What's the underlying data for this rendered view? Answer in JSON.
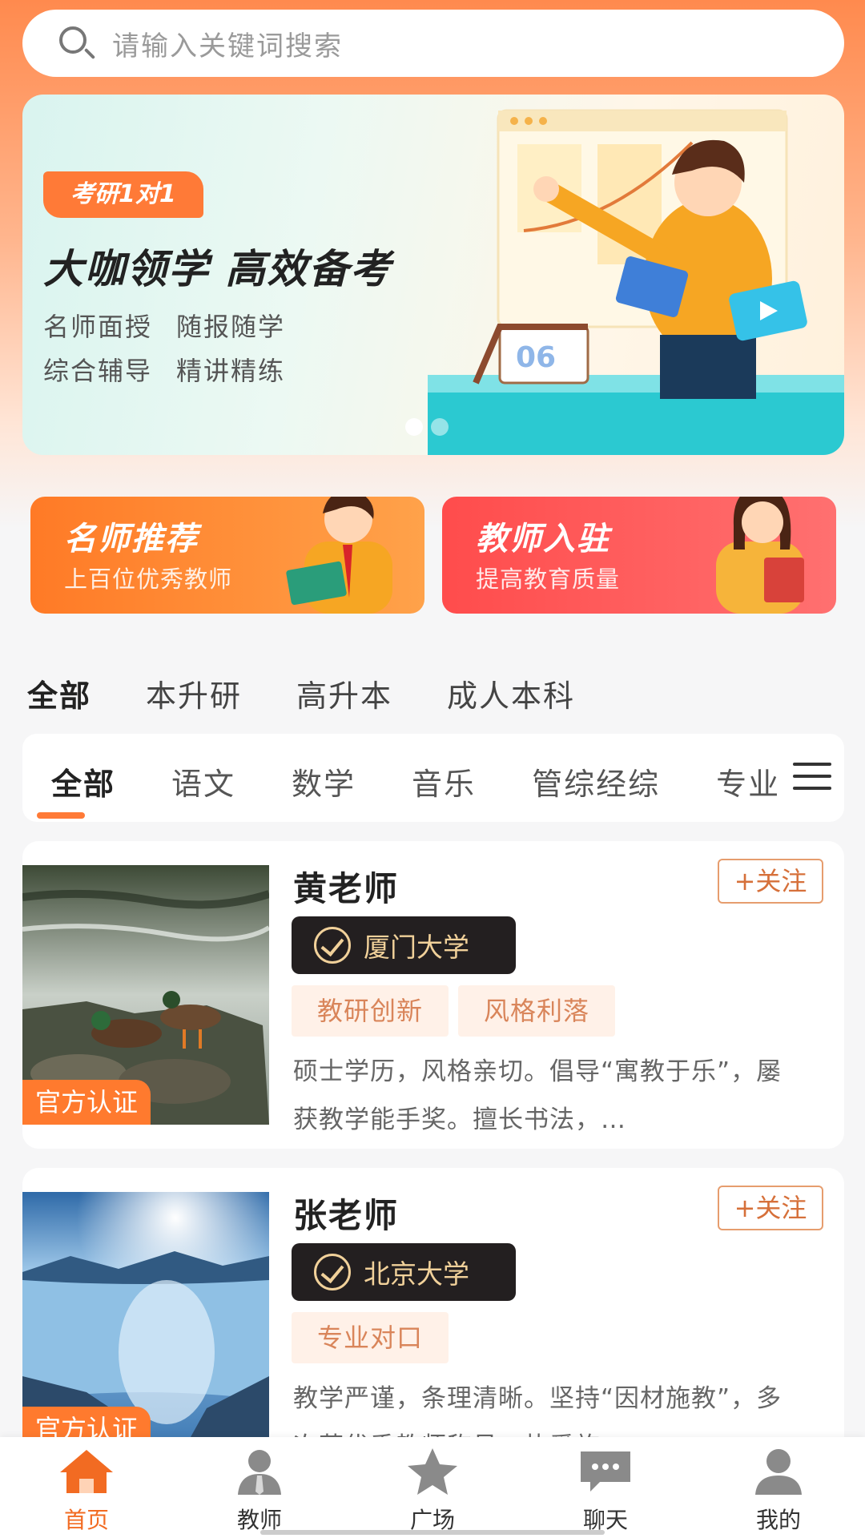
{
  "search": {
    "placeholder": "请输入关键词搜索"
  },
  "banner": {
    "tag": "考研1对1",
    "title": "大咖领学  高效备考",
    "line1": [
      "名师面授",
      "随报随学"
    ],
    "line2": [
      "综合辅导",
      "精讲精练"
    ],
    "calendar_number": "06"
  },
  "promos": [
    {
      "title": "名师推荐",
      "subtitle": "上百位优秀教师"
    },
    {
      "title": "教师入驻",
      "subtitle": "提高教育质量"
    }
  ],
  "category_tabs": [
    "全部",
    "本升研",
    "高升本",
    "成人本科"
  ],
  "subject_tabs": [
    "全部",
    "语文",
    "数学",
    "音乐",
    "管综经综",
    "专业"
  ],
  "teachers": [
    {
      "name": "黄老师",
      "follow": "+关注",
      "school": "厦门大学",
      "tags": [
        "教研创新",
        "风格利落"
      ],
      "description": "硕士学历，风格亲切。倡导“寓教于乐”，屡获教学能手奖。擅长书法，…",
      "badge": "官方认证"
    },
    {
      "name": "张老师",
      "follow": "+关注",
      "school": "北京大学",
      "tags": [
        "专业对口"
      ],
      "description": "教学严谨，条理清晰。坚持“因材施教”，多次获优秀教师称号，热爱旅",
      "badge": "官方认证"
    }
  ],
  "nav": [
    {
      "label": "首页",
      "icon": "home-icon"
    },
    {
      "label": "教师",
      "icon": "teacher-icon"
    },
    {
      "label": "广场",
      "icon": "star-icon"
    },
    {
      "label": "聊天",
      "icon": "chat-icon"
    },
    {
      "label": "我的",
      "icon": "profile-icon"
    }
  ],
  "colors": {
    "accent": "#ff7a37",
    "nav_active": "#f26b22",
    "school_badge_bg": "#231f20",
    "promo_red": "#ff4c4c"
  }
}
